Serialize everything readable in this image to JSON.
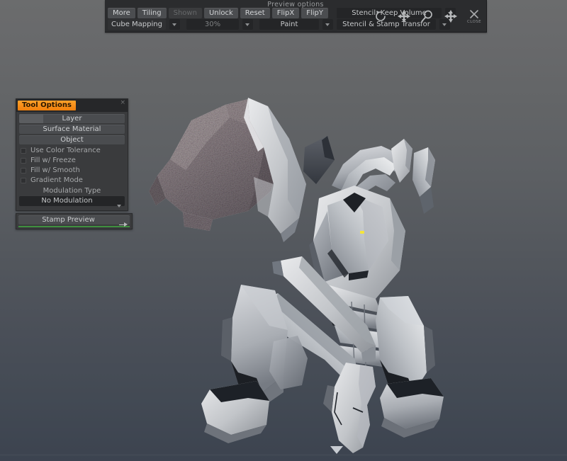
{
  "app": {
    "background_top": "#6b6c6d",
    "background_bottom": "#3c4350",
    "accent": "#f0830e"
  },
  "toolbar": {
    "title": "Preview options",
    "row1": [
      {
        "label": "More",
        "state": "normal"
      },
      {
        "label": "Tiling",
        "state": "normal"
      },
      {
        "label": "Shown",
        "state": "disabled"
      },
      {
        "label": "Unlock",
        "state": "normal"
      },
      {
        "label": "Reset",
        "state": "normal"
      },
      {
        "label": "FlipX",
        "state": "normal"
      },
      {
        "label": "FlipY",
        "state": "normal"
      }
    ],
    "stencil_mode": "Stencil: Keep Volume",
    "row2": {
      "mapping": "Cube Mapping",
      "opacity": "30%",
      "paint": "Paint",
      "transform": "Stencil & Stamp Transfor"
    },
    "icons": [
      {
        "name": "rotate-icon",
        "label": ""
      },
      {
        "name": "move-icon",
        "label": ""
      },
      {
        "name": "zoom-icon",
        "label": ""
      },
      {
        "name": "scale-icon",
        "label": ""
      },
      {
        "name": "close-icon",
        "label": "CLOSE"
      }
    ]
  },
  "palette": {
    "title": "Tool Options",
    "close_glyph": "×",
    "buttons": [
      {
        "label": "Layer",
        "slider": true
      },
      {
        "label": "Surface Material",
        "slider": false
      },
      {
        "label": "Object",
        "slider": false
      }
    ],
    "checkboxes": [
      {
        "label": "Use Color Tolerance",
        "checked": false
      },
      {
        "label": "Fill w/ Freeze",
        "checked": false
      },
      {
        "label": "Fill w/ Smooth",
        "checked": false
      },
      {
        "label": "Gradient Mode",
        "checked": false
      }
    ],
    "modulation_label": "Modulation Type",
    "modulation_value": "No Modulation"
  },
  "stamp_preview": {
    "label": "Stamp Preview"
  },
  "viewport": {
    "cursor_color": "#f5e53a"
  }
}
